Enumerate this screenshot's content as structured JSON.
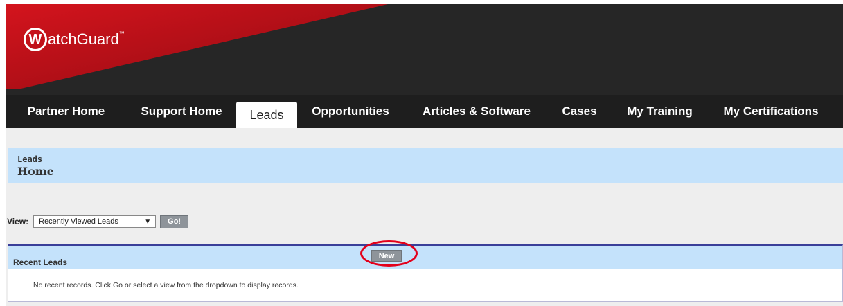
{
  "brand": {
    "logo_letter": "W",
    "logo_text": "atchGuard",
    "logo_mark": "™",
    "colors": {
      "header_bg": "#262626",
      "wedge_red": "#b30d17",
      "nav_bg": "#1e1e1e",
      "page_header_bg": "#c4e2fb",
      "highlight": "#e3001b"
    }
  },
  "nav": {
    "tabs": [
      {
        "label": "Partner Home",
        "active": false
      },
      {
        "label": "Support Home",
        "active": false
      },
      {
        "label": "Leads",
        "active": true
      },
      {
        "label": "Opportunities",
        "active": false
      },
      {
        "label": "Articles & Software",
        "active": false
      },
      {
        "label": "Cases",
        "active": false
      },
      {
        "label": "My Training",
        "active": false
      },
      {
        "label": "My Certifications",
        "active": false
      }
    ]
  },
  "page_header": {
    "type": "Leads",
    "title": "Home"
  },
  "view": {
    "label": "View:",
    "selected": "Recently Viewed Leads",
    "go_label": "Go!"
  },
  "recent": {
    "title": "Recent Leads",
    "new_label": "New",
    "empty_message": "No recent records. Click Go or select a view from the dropdown to display records."
  }
}
